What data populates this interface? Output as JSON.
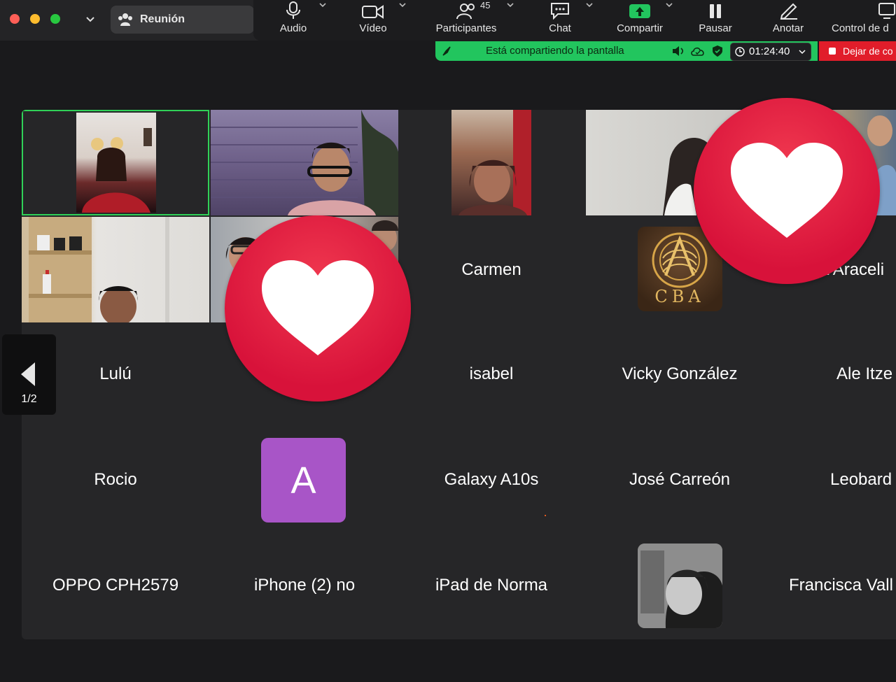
{
  "window": {
    "title": "Reunión"
  },
  "toolbar": {
    "audio": "Audio",
    "video": "Vídeo",
    "participants": "Participantes",
    "participants_count": "45",
    "chat": "Chat",
    "share": "Compartir",
    "pause": "Pausar",
    "annotate": "Anotar",
    "remote_control": "Control de d"
  },
  "share_bar": {
    "status": "Está compartiendo la pantalla",
    "timer": "01:24:40",
    "stop": "Dejar de co"
  },
  "pager": {
    "label": "1/2"
  },
  "tiles": {
    "carmen": "Carmen",
    "araceli": "a Araceli",
    "lulu": "Lulú",
    "isabel": "isabel",
    "vicky": "Vicky González",
    "ale": "Ale Itze",
    "rocio": "Rocio",
    "avatar_letter": "A",
    "galaxy": "Galaxy A10s",
    "jose": "José Carreón",
    "leobardo": "Leobard",
    "oppo": "OPPO CPH2579",
    "iphone": "iPhone (2) no",
    "ipad": "iPad de Norma",
    "francisca": "Francisca Vall",
    "cba_logo": "CBA"
  },
  "colors": {
    "active_speaker": "#30d158",
    "share_green": "#22c55e",
    "stop_red": "#e11d2a",
    "heart_red": "#e01e3e",
    "avatar_purple": "#a855c7"
  }
}
